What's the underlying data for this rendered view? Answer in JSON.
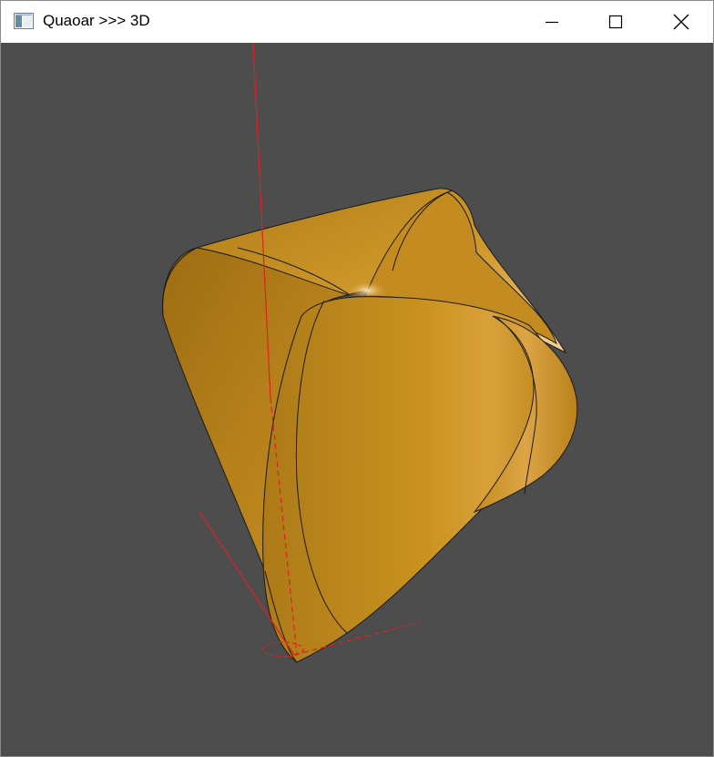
{
  "window": {
    "title": "Quaoar >>> 3D",
    "controls": {
      "minimize_icon": "minimize-icon",
      "maximize_icon": "maximize-icon",
      "close_icon": "close-icon"
    }
  },
  "viewport": {
    "background_color": "#4d4d4d",
    "shape_color": "#c8901e",
    "edge_color": "#1a1a1a",
    "axis_color": "#e02020"
  }
}
